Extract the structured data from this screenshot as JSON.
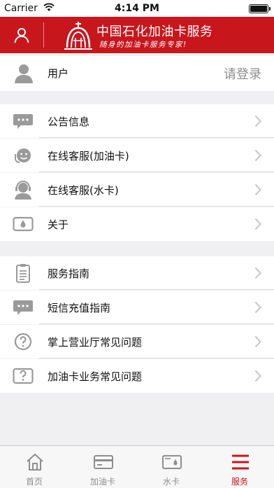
{
  "status_bar": {
    "carrier": "Carrier",
    "time": "4:14 PM"
  },
  "header": {
    "brand": "中国石化加油卡服务",
    "slogan": "随身的加油卡服务专家!"
  },
  "user_row": {
    "label": "用户",
    "action": "请登录"
  },
  "section1": [
    {
      "label": "公告信息",
      "icon": "chat-bubble-icon"
    },
    {
      "label": "在线客服(加油卡)",
      "icon": "customer-service-icon"
    },
    {
      "label": "在线客服(水卡)",
      "icon": "headset-agent-icon"
    },
    {
      "label": "关于",
      "icon": "water-drop-card-icon"
    }
  ],
  "section2": [
    {
      "label": "服务指南",
      "icon": "clipboard-icon"
    },
    {
      "label": "短信充值指南",
      "icon": "chat-bubble-icon"
    },
    {
      "label": "掌上营业厅常见问题",
      "icon": "question-circle-icon"
    },
    {
      "label": "加油卡业务常见问题",
      "icon": "question-box-icon"
    }
  ],
  "tabs": [
    {
      "label": "首页",
      "icon": "home-icon",
      "active": false
    },
    {
      "label": "加油卡",
      "icon": "fuel-card-icon",
      "active": false
    },
    {
      "label": "水卡",
      "icon": "water-card-icon",
      "active": false
    },
    {
      "label": "服务",
      "icon": "menu-icon",
      "active": true
    }
  ],
  "colors": {
    "brand_red": "#c8161d",
    "icon_gray": "#8e8e8e",
    "background": "#f0f0f2"
  }
}
